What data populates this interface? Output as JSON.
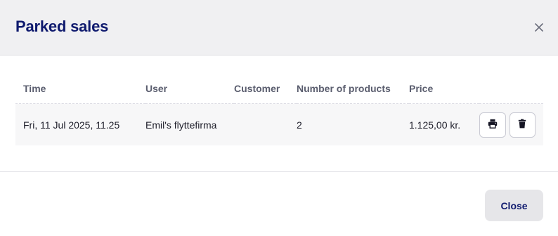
{
  "modal": {
    "title": "Parked sales",
    "close_button_label": "Close"
  },
  "table": {
    "columns": [
      "Time",
      "User",
      "Customer",
      "Number of products",
      "Price"
    ],
    "rows": [
      {
        "time": "Fri, 11 Jul 2025, 11.25",
        "user": "Emil's flyttefirma",
        "customer": "",
        "number_of_products": "2",
        "price": "1.125,00 kr."
      }
    ]
  },
  "icons": {
    "close": "close-icon",
    "print": "printer-icon",
    "delete": "trash-icon"
  },
  "colors": {
    "title": "#0f1a6e",
    "header_background": "#f0f0f2",
    "row_background": "#f7f7f8",
    "close_button_background": "#e6e6e9"
  }
}
